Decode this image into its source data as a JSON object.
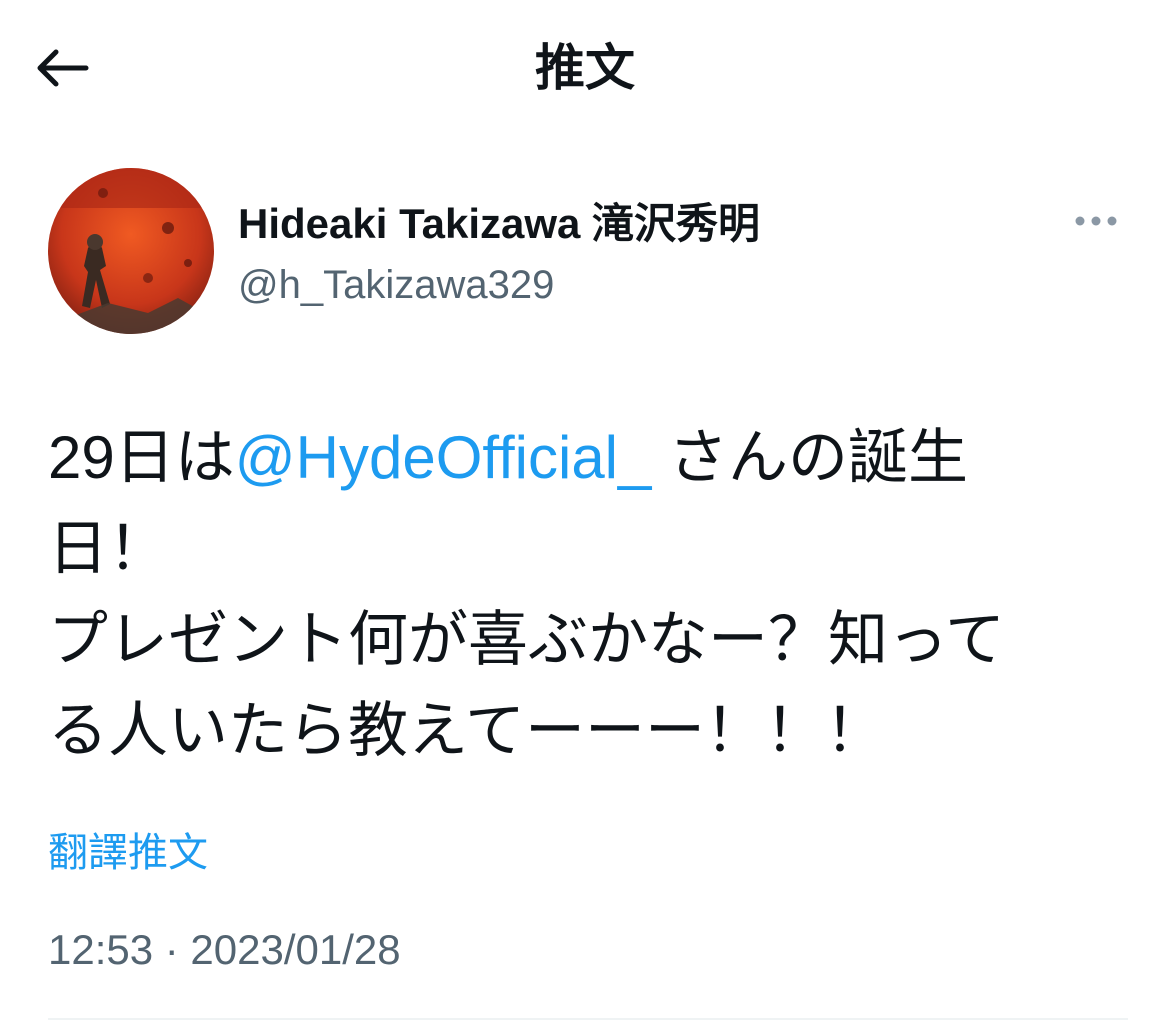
{
  "header": {
    "title": "推文",
    "back_icon": "arrow-left-icon"
  },
  "author": {
    "display_name": "Hideaki Takizawa 滝沢秀明",
    "handle": "@h_Takizawa329",
    "more_icon": "more-horizontal-icon"
  },
  "tweet": {
    "line1_a": "29日は",
    "mention": "@HydeOfficial_",
    "line1_b": " さんの誕生",
    "line2": "日！",
    "line3": "プレゼント何が喜ぶかなー？知って",
    "line4": "る人いたら教えてーーー！！！"
  },
  "translate_label": "翻譯推文",
  "timestamp": "12:53 · 2023/01/28",
  "colors": {
    "accent": "#1d9bf0",
    "text": "#0f1419",
    "secondary": "#536471"
  }
}
